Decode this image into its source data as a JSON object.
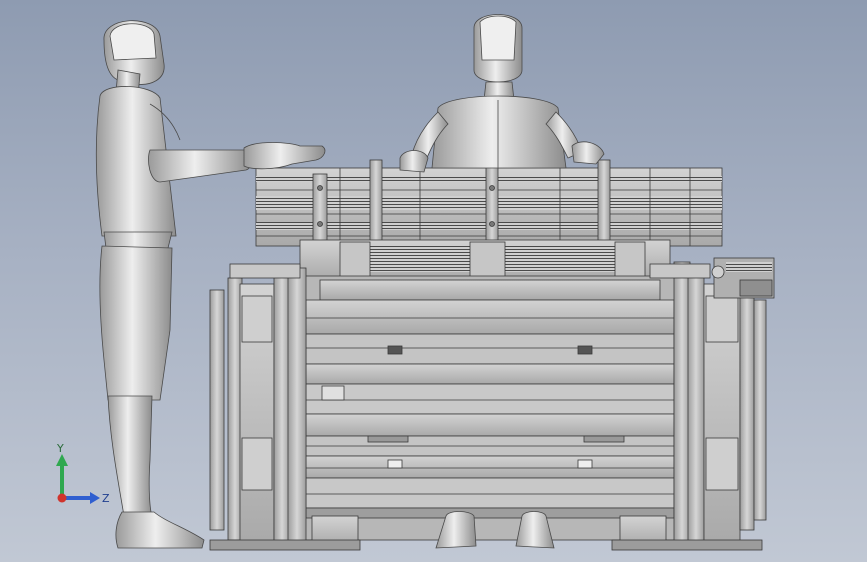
{
  "viewport": {
    "background_top": "#8e9bb1",
    "background_bottom": "#c1c8d4"
  },
  "triad": {
    "y_label": "Y",
    "z_label": "Z",
    "y_color": "#2fa84f",
    "z_color": "#2f5fd0",
    "x_color": "#d0342c"
  },
  "model": {
    "mannequin_color": "#d9d9d9",
    "frame_color": "#bcbcbc",
    "edge_color": "#3a3a3a"
  }
}
